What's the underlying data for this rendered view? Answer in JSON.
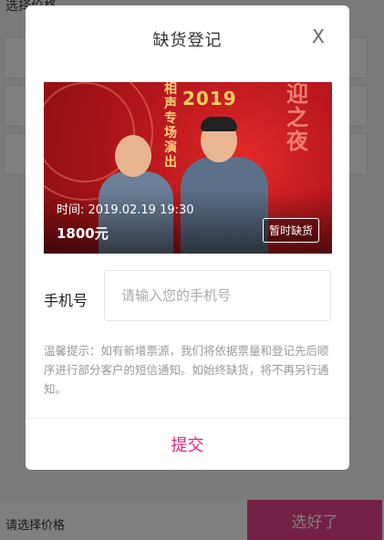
{
  "background": {
    "top_label": "选择价格",
    "bottom_label": "请选择价格",
    "confirm_label": "选好了"
  },
  "modal": {
    "title": "缺货登记",
    "close_symbol": "X",
    "poster": {
      "title_vertical": "相声专场演出",
      "year": "2019",
      "big_chars": "迎之夜",
      "time_text": "时间: 2019.02.19 19:30",
      "price": "1800元",
      "badge": "暂时缺货"
    },
    "phone": {
      "label": "手机号",
      "placeholder": "请输入您的手机号",
      "value": ""
    },
    "tips": "温馨提示：如有新增票源，我们将依据票量和登记先后顺序进行部分客户的短信通知。如始终缺货，将不再另行通知。",
    "submit_label": "提交"
  },
  "colors": {
    "accent": "#e2237f",
    "poster_red": "#b8171d"
  }
}
